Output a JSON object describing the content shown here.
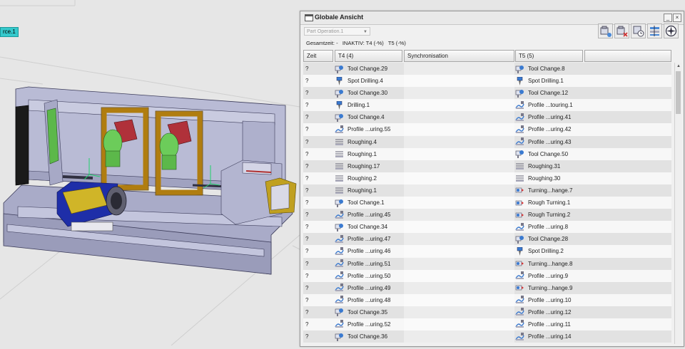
{
  "viewport": {
    "label_tag": "rce.1"
  },
  "panel": {
    "title": "Globale Ansicht",
    "combo_value": "Part Operation.1",
    "summary": "Gesamtzeit: -   INAKTIV: T4 (-%)   T5 (-%)",
    "columns": [
      "Zeit",
      "T4 (4)",
      "Synchronisation",
      "T5 (5)"
    ],
    "toolbar_icons": [
      "machine-add-icon",
      "machine-remove-icon",
      "machine-clock-icon",
      "sync-align-icon",
      "compass-icon"
    ],
    "rows": [
      {
        "zeit": "?",
        "t4": "Tool Change.29",
        "t4_icon": "tool",
        "t5": "Tool Change.8",
        "t5_icon": "tool"
      },
      {
        "zeit": "?",
        "t4": "Spot Drilling.4",
        "t4_icon": "drill",
        "t5": "Spot Drilling.1",
        "t5_icon": "drill"
      },
      {
        "zeit": "?",
        "t4": "Tool Change.30",
        "t4_icon": "tool",
        "t5": "Tool Change.12",
        "t5_icon": "tool"
      },
      {
        "zeit": "?",
        "t4": "Drilling.1",
        "t4_icon": "drill",
        "t5": "Profile ...touring.1",
        "t5_icon": "profile"
      },
      {
        "zeit": "?",
        "t4": "Tool Change.4",
        "t4_icon": "tool",
        "t5": "Profile ...uring.41",
        "t5_icon": "profile"
      },
      {
        "zeit": "?",
        "t4": "Profile ...uring.55",
        "t4_icon": "profile",
        "t5": "Profile ...uring.42",
        "t5_icon": "profile"
      },
      {
        "zeit": "?",
        "t4": "Roughing.4",
        "t4_icon": "rough",
        "t5": "Profile ...uring.43",
        "t5_icon": "profile"
      },
      {
        "zeit": "?",
        "t4": "Roughing.1",
        "t4_icon": "rough",
        "t5": "Tool Change.50",
        "t5_icon": "tool"
      },
      {
        "zeit": "?",
        "t4": "Roughing.17",
        "t4_icon": "rough",
        "t5": "Roughing.31",
        "t5_icon": "rough"
      },
      {
        "zeit": "?",
        "t4": "Roughing.2",
        "t4_icon": "rough",
        "t5": "Roughing.30",
        "t5_icon": "rough"
      },
      {
        "zeit": "?",
        "t4": "Roughing.1",
        "t4_icon": "rough",
        "t5": "Turning...hange.7",
        "t5_icon": "turn"
      },
      {
        "zeit": "?",
        "t4": "Tool Change.1",
        "t4_icon": "tool",
        "t5": "Rough Turning.1",
        "t5_icon": "turn"
      },
      {
        "zeit": "?",
        "t4": "Profile ...uring.45",
        "t4_icon": "profile",
        "t5": "Rough Turning.2",
        "t5_icon": "turn"
      },
      {
        "zeit": "?",
        "t4": "Tool Change.34",
        "t4_icon": "tool",
        "t5": "Profile ...uring.8",
        "t5_icon": "profile"
      },
      {
        "zeit": "?",
        "t4": "Profile ...uring.47",
        "t4_icon": "profile",
        "t5": "Tool Change.28",
        "t5_icon": "tool"
      },
      {
        "zeit": "?",
        "t4": "Profile ...uring.46",
        "t4_icon": "profile",
        "t5": "Spot Drilling.2",
        "t5_icon": "drill"
      },
      {
        "zeit": "?",
        "t4": "Profile ...uring.51",
        "t4_icon": "profile",
        "t5": "Turning...hange.8",
        "t5_icon": "turn"
      },
      {
        "zeit": "?",
        "t4": "Profile ...uring.50",
        "t4_icon": "profile",
        "t5": "Profile ...uring.9",
        "t5_icon": "profile"
      },
      {
        "zeit": "?",
        "t4": "Profile ...uring.49",
        "t4_icon": "profile",
        "t5": "Turning...hange.9",
        "t5_icon": "turn"
      },
      {
        "zeit": "?",
        "t4": "Profile ...uring.48",
        "t4_icon": "profile",
        "t5": "Profile ...uring.10",
        "t5_icon": "profile"
      },
      {
        "zeit": "?",
        "t4": "Tool Change.35",
        "t4_icon": "tool",
        "t5": "Profile ...uring.12",
        "t5_icon": "profile"
      },
      {
        "zeit": "?",
        "t4": "Profile ...uring.52",
        "t4_icon": "profile",
        "t5": "Profile ...uring.11",
        "t5_icon": "profile"
      },
      {
        "zeit": "?",
        "t4": "Tool Change.36",
        "t4_icon": "tool",
        "t5": "Profile ...uring.14",
        "t5_icon": "profile"
      }
    ]
  }
}
